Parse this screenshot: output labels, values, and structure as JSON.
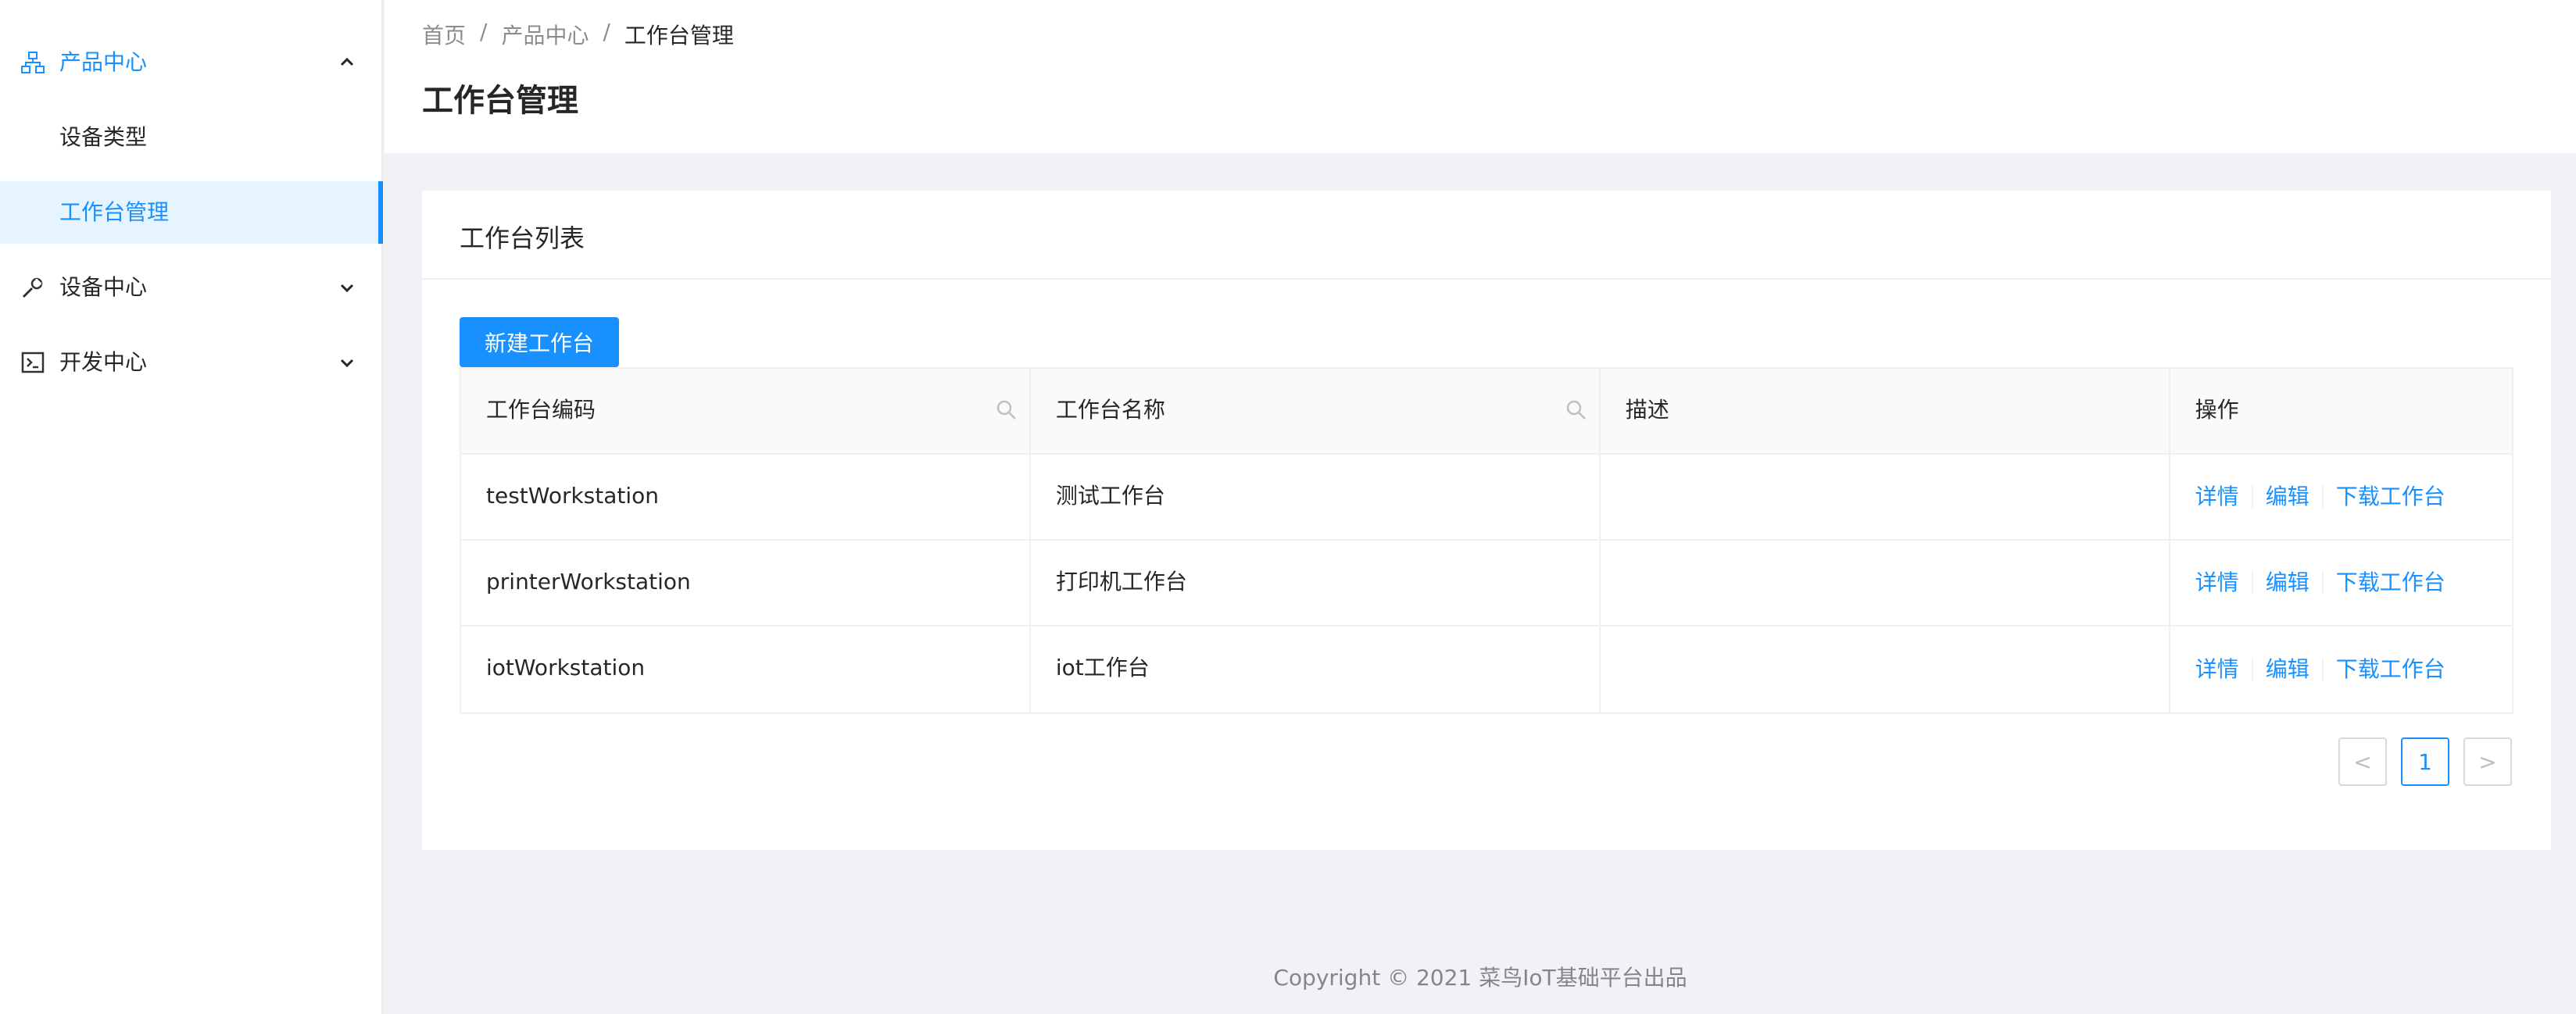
{
  "sidebar": {
    "groups": [
      {
        "label": "产品中心",
        "icon": "cluster-icon",
        "expanded": true
      },
      {
        "label": "设备中心",
        "icon": "tool-icon",
        "expanded": false
      },
      {
        "label": "开发中心",
        "icon": "code-icon",
        "expanded": false
      }
    ],
    "subitems": [
      {
        "label": "设备类型",
        "active": false
      },
      {
        "label": "工作台管理",
        "active": true
      }
    ]
  },
  "breadcrumb": {
    "items": [
      "首页",
      "产品中心",
      "工作台管理"
    ],
    "separator": "/"
  },
  "page": {
    "title": "工作台管理"
  },
  "card": {
    "title": "工作台列表",
    "new_button": "新建工作台"
  },
  "table": {
    "columns": [
      "工作台编码",
      "工作台名称",
      "描述",
      "操作"
    ],
    "rows": [
      {
        "code": "testWorkstation",
        "name": "测试工作台",
        "desc": ""
      },
      {
        "code": "printerWorkstation",
        "name": "打印机工作台",
        "desc": ""
      },
      {
        "code": "iotWorkstation",
        "name": "iot工作台",
        "desc": ""
      }
    ],
    "actions": [
      "详情",
      "编辑",
      "下载工作台"
    ]
  },
  "pagination": {
    "prev": "<",
    "current": "1",
    "next": ">"
  },
  "footer": {
    "text": "Copyright © 2021 菜鸟IoT基础平台出品"
  },
  "colors": {
    "accent": "#1890ff",
    "bg": "#f0f2f5"
  }
}
